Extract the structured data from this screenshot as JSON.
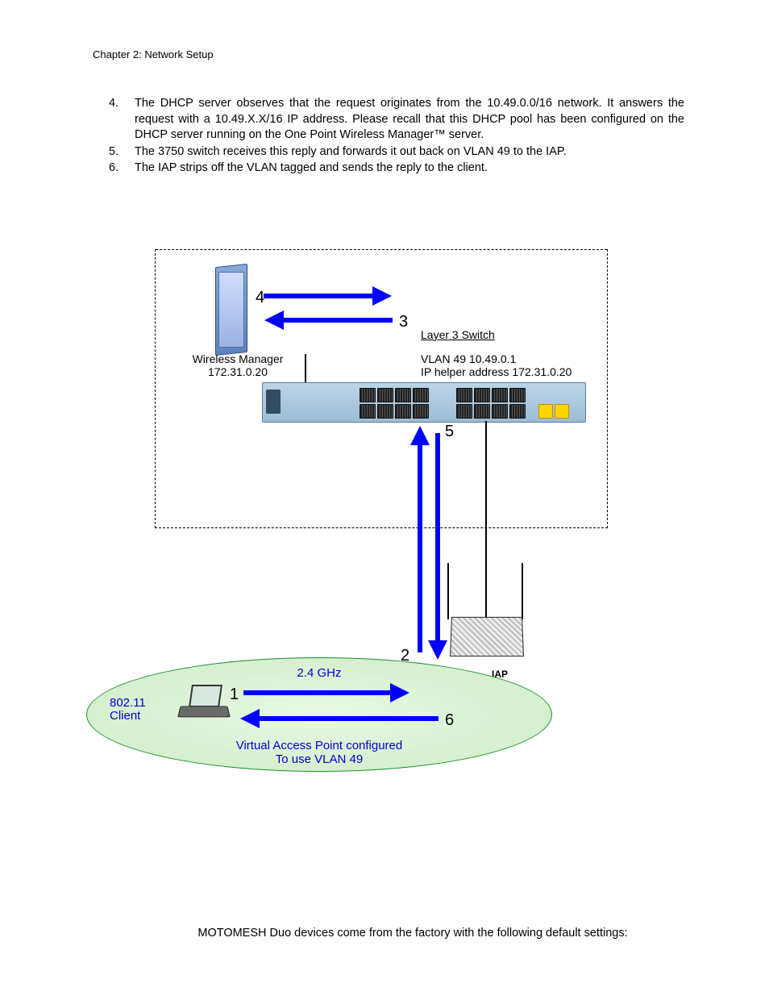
{
  "header": {
    "chapter": "Chapter 2: Network Setup"
  },
  "steps": [
    {
      "n": "4.",
      "text": "The DHCP server observes that the request originates from the 10.49.0.0/16 network.  It answers the request with a 10.49.X.X/16 IP address.  Please recall that this DHCP pool has been configured on the DHCP server running on the One Point Wireless Manager™ server.",
      "justify": true
    },
    {
      "n": "5.",
      "text": "The 3750 switch receives this reply and forwards it out back on VLAN 49 to the IAP."
    },
    {
      "n": "6.",
      "text": "The IAP strips off the VLAN tagged and sends the reply to the client."
    }
  ],
  "diagram": {
    "server_label_line1": "Wireless Manager",
    "server_label_line2": "172.31.0.20",
    "l3_switch": "Layer 3 Switch",
    "vlan_line1": "VLAN 49 10.49.0.1",
    "vlan_line2": "IP helper address 172.31.0.20",
    "iap": "IAP",
    "ghz": "2.4 GHz",
    "client_line1": "802.11",
    "client_line2": "Client",
    "vap_line1": "Virtual Access Point configured",
    "vap_line2": "To use VLAN 49",
    "n1": "1",
    "n2": "2",
    "n3": "3",
    "n4": "4",
    "n5": "5",
    "n6": "6"
  },
  "footer": {
    "text": "MOTOMESH Duo devices come from the factory with the following default settings:"
  }
}
